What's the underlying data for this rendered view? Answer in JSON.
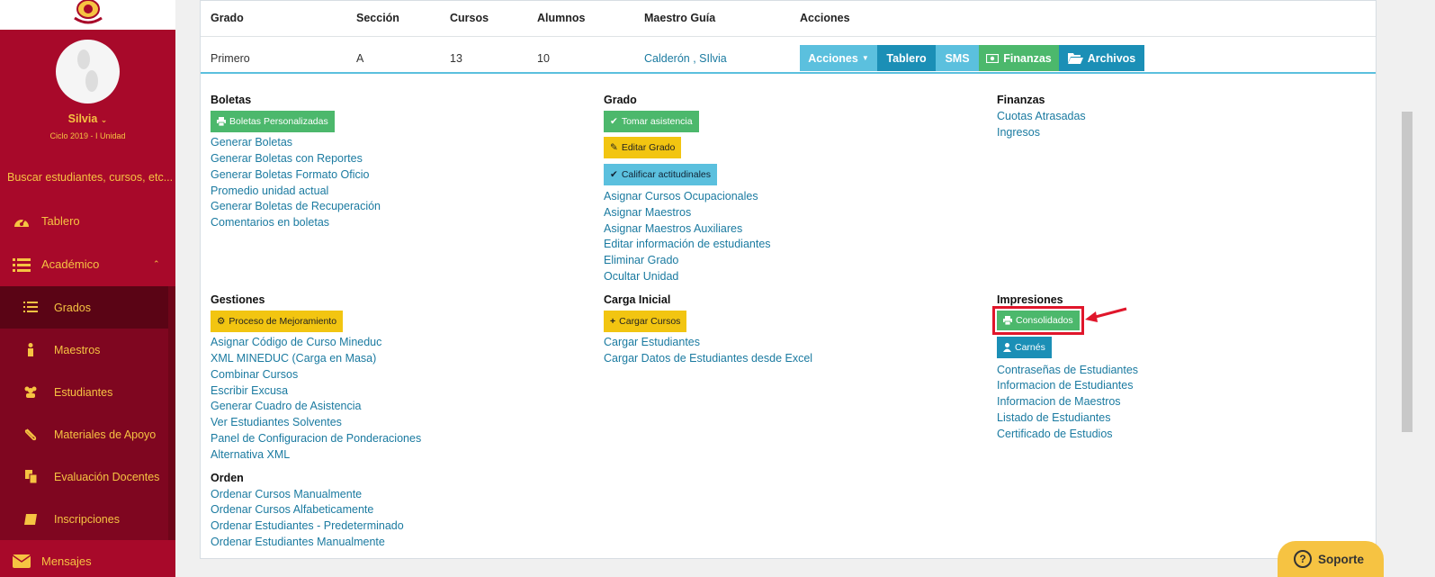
{
  "sidebar": {
    "user_name": "Silvia",
    "cycle": "Ciclo 2019 - I Unidad",
    "search_placeholder": "Buscar estudiantes, cursos, etc...",
    "items": [
      {
        "label": "Tablero",
        "icon": "dashboard-icon"
      },
      {
        "label": "Académico",
        "icon": "list-icon"
      },
      {
        "label": "Mensajes",
        "icon": "envelope-icon"
      }
    ],
    "sub_items": [
      {
        "label": "Grados",
        "icon": "list-icon"
      },
      {
        "label": "Maestros",
        "icon": "person-icon"
      },
      {
        "label": "Estudiantes",
        "icon": "users-icon"
      },
      {
        "label": "Materiales de Apoyo",
        "icon": "paperclip-icon"
      },
      {
        "label": "Evaluación Docentes",
        "icon": "copy-icon"
      },
      {
        "label": "Inscripciones",
        "icon": "book-icon"
      }
    ]
  },
  "table": {
    "headers": [
      "Grado",
      "Sección",
      "Cursos",
      "Alumnos",
      "Maestro Guía",
      "Acciones"
    ],
    "row": {
      "grado": "Primero",
      "seccion": "A",
      "cursos": "13",
      "alumnos": "10",
      "maestro": "Calderón , SIlvia"
    },
    "actions": {
      "acciones": "Acciones",
      "tablero": "Tablero",
      "sms": "SMS",
      "finanzas": "Finanzas",
      "archivos": "Archivos"
    }
  },
  "sections": {
    "boletas": {
      "title": "Boletas",
      "button": "Boletas Personalizadas",
      "links": [
        "Generar Boletas",
        "Generar Boletas con Reportes",
        "Generar Boletas Formato Oficio",
        "Promedio unidad actual",
        "Generar Boletas de Recuperación",
        "Comentarios en boletas"
      ]
    },
    "grado": {
      "title": "Grado",
      "buttons": [
        "Tomar asistencia",
        "Editar Grado",
        "Calificar actitudinales"
      ],
      "links": [
        "Asignar Cursos Ocupacionales",
        "Asignar Maestros",
        "Asignar Maestros Auxiliares",
        "Editar información de estudiantes",
        "Eliminar Grado",
        "Ocultar Unidad"
      ]
    },
    "finanzas": {
      "title": "Finanzas",
      "links": [
        "Cuotas Atrasadas",
        "Ingresos"
      ]
    },
    "gestiones": {
      "title": "Gestiones",
      "button": "Proceso de Mejoramiento",
      "links": [
        "Asignar Código de Curso Mineduc",
        "XML MINEDUC (Carga en Masa)",
        "Combinar Cursos",
        "Escribir Excusa",
        "Generar Cuadro de Asistencia",
        "Ver Estudiantes Solventes",
        "Panel de Configuracion de Ponderaciones",
        "Alternativa XML"
      ]
    },
    "carga": {
      "title": "Carga Inicial",
      "button": "Cargar Cursos",
      "links": [
        "Cargar Estudiantes",
        "Cargar Datos de Estudiantes desde Excel"
      ]
    },
    "impresiones": {
      "title": "Impresiones",
      "buttons": [
        "Consolidados",
        "Carnés"
      ],
      "links": [
        "Contraseñas de Estudiantes",
        "Informacion de Estudiantes",
        "Informacion de Maestros",
        "Listado de Estudiantes",
        "Certificado de Estudios"
      ]
    },
    "orden": {
      "title": "Orden",
      "links": [
        "Ordenar Cursos Manualmente",
        "Ordenar Cursos Alfabeticamente",
        "Ordenar Estudiantes - Predeterminado",
        "Ordenar Estudiantes Manualmente"
      ]
    }
  },
  "support": {
    "label": "Soporte"
  },
  "colors": {
    "sidebar": "#a8092a",
    "sidebar_text": "#f6c342",
    "link": "#1a7aa0",
    "green": "#4cb86c",
    "yellow": "#f2c511",
    "light_blue": "#5bc0de",
    "dark_blue": "#1b8fb6",
    "highlight": "#e0162b"
  }
}
